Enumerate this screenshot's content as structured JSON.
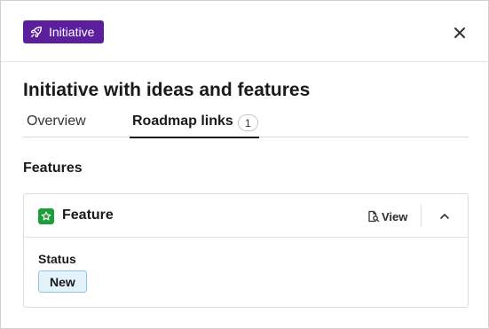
{
  "header": {
    "badge_label": "Initiative",
    "badge_icon": "rocket-icon",
    "close_icon": "close-icon"
  },
  "title": "Initiative with ideas and features",
  "tabs": [
    {
      "label": "Overview"
    },
    {
      "label": "Roadmap links",
      "count": "1",
      "active": true
    }
  ],
  "section": {
    "heading": "Features"
  },
  "card": {
    "icon": "star-icon",
    "title": "Feature",
    "view_label": "View",
    "status_label": "Status",
    "status_value": "New"
  },
  "colors": {
    "badge_bg": "#5b1f9e",
    "feature_icon_bg": "#1f9d3a",
    "status_bg": "#e4f2fb",
    "status_border": "#8fc3e3"
  }
}
